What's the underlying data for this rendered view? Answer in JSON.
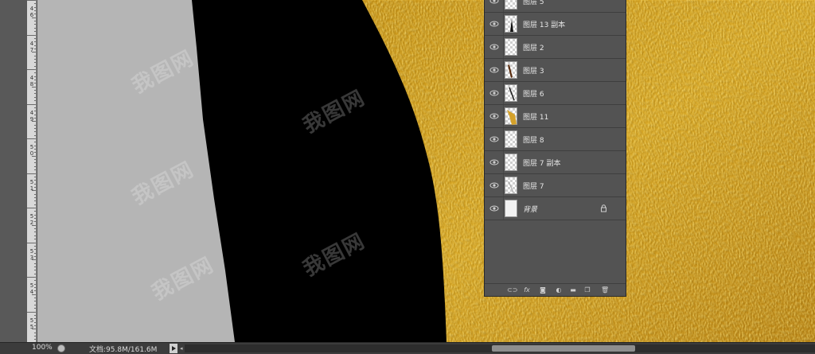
{
  "ruler": {
    "labels": [
      "4 6",
      "4 7",
      "4 8",
      "4 9",
      "5 0",
      "5 1",
      "5 2",
      "5 3",
      "5 4",
      "5 5"
    ]
  },
  "layers": [
    {
      "name": "图层 5",
      "thumb": "transparent"
    },
    {
      "name": "图层 13 副本",
      "thumb": "dark-figure"
    },
    {
      "name": "图层 2",
      "thumb": "transparent"
    },
    {
      "name": "图层 3",
      "thumb": "brown-stroke"
    },
    {
      "name": "图层 6",
      "thumb": "dark-stroke"
    },
    {
      "name": "图层 11",
      "thumb": "gold-stroke"
    },
    {
      "name": "图层 8",
      "thumb": "transparent"
    },
    {
      "name": "图层 7 副本",
      "thumb": "transparent"
    },
    {
      "name": "图层 7",
      "thumb": "light-stroke"
    },
    {
      "name": "背景",
      "thumb": "plain",
      "locked": true
    }
  ],
  "panel_footer_icons": [
    "link-icon",
    "fx-icon",
    "mask-icon",
    "adjustment-icon",
    "folder-icon",
    "new-layer-icon",
    "trash-icon"
  ],
  "panel_footer_labels": {
    "fx": "fx"
  },
  "status": {
    "zoom": "100%",
    "doc_info": "文档:95.8M/161.6M"
  },
  "watermark": "我图网",
  "colors": {
    "gray_panel": "#b5b5b5",
    "black_shape": "#000000",
    "gold": "#c99a1e"
  }
}
